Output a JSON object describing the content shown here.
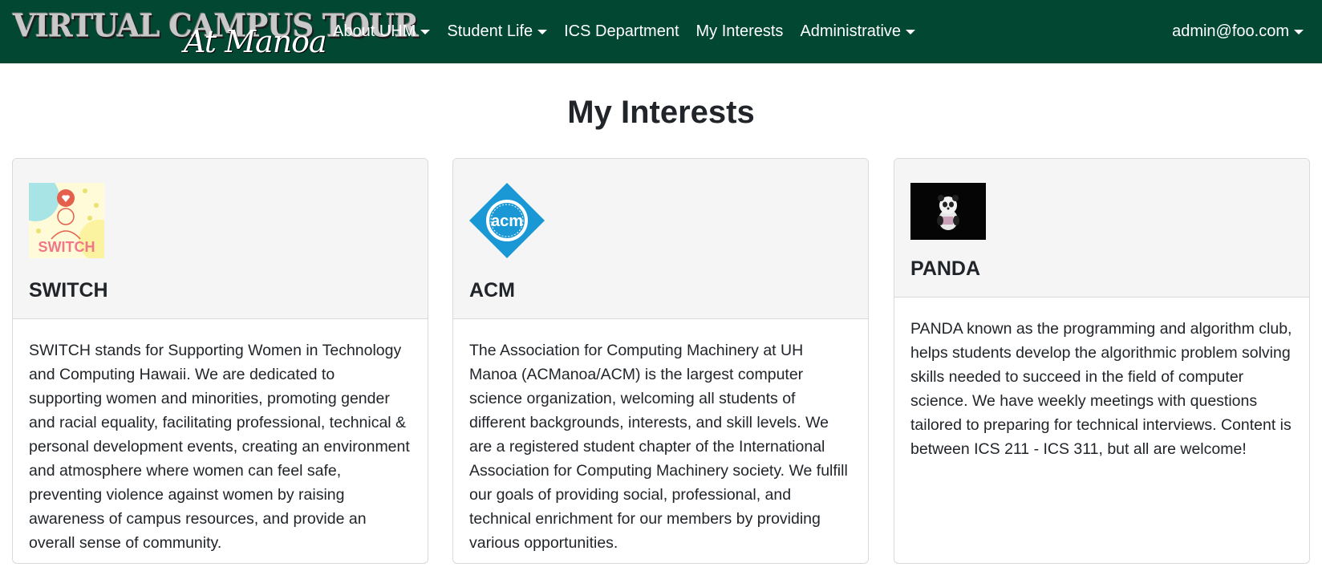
{
  "navbar": {
    "brand_main": "VIRTUAL CAMPUS TOUR",
    "brand_script": "At Manoa",
    "items": [
      {
        "label": "About UHM",
        "dropdown": true
      },
      {
        "label": "Student Life",
        "dropdown": true
      },
      {
        "label": "ICS Department",
        "dropdown": false
      },
      {
        "label": "My Interests",
        "dropdown": false
      },
      {
        "label": "Administrative",
        "dropdown": true
      }
    ],
    "user": "admin@foo.com"
  },
  "page": {
    "title": "My Interests"
  },
  "cards": [
    {
      "title": "SWITCH",
      "logo_text": "SWITCH",
      "logo_icon": "switch-logo-icon",
      "description": "SWITCH stands for Supporting Women in Technology and Computing Hawaii. We are dedicated to supporting women and minorities, promoting gender and racial equality, facilitating professional, technical & personal development events, creating an environment and atmosphere where women can feel safe, preventing violence against women by raising awareness of campus resources, and provide an overall sense of community."
    },
    {
      "title": "ACM",
      "logo_text": "acm",
      "logo_icon": "acm-logo-icon",
      "description": "The Association for Computing Machinery at UH Manoa (ACManoa/ACM) is the largest computer science organization, welcoming all students of different backgrounds, interests, and skill levels. We are a registered student chapter of the International Association for Computing Machinery society. We fulfill our goals of providing social, professional, and technical enrichment for our members by providing various opportunities."
    },
    {
      "title": "PANDA",
      "logo_icon": "panda-logo-icon",
      "description": "PANDA known as the programming and algorithm club, helps students develop the algorithmic problem solving skills needed to succeed in the field of computer science. We have weekly meetings with questions tailored to preparing for technical interviews. Content is between ICS 211 - ICS 311, but all are welcome!"
    }
  ],
  "colors": {
    "navbar_bg": "#024731",
    "card_header_bg": "#f5f5f5",
    "acm_blue": "#1a98d5"
  }
}
